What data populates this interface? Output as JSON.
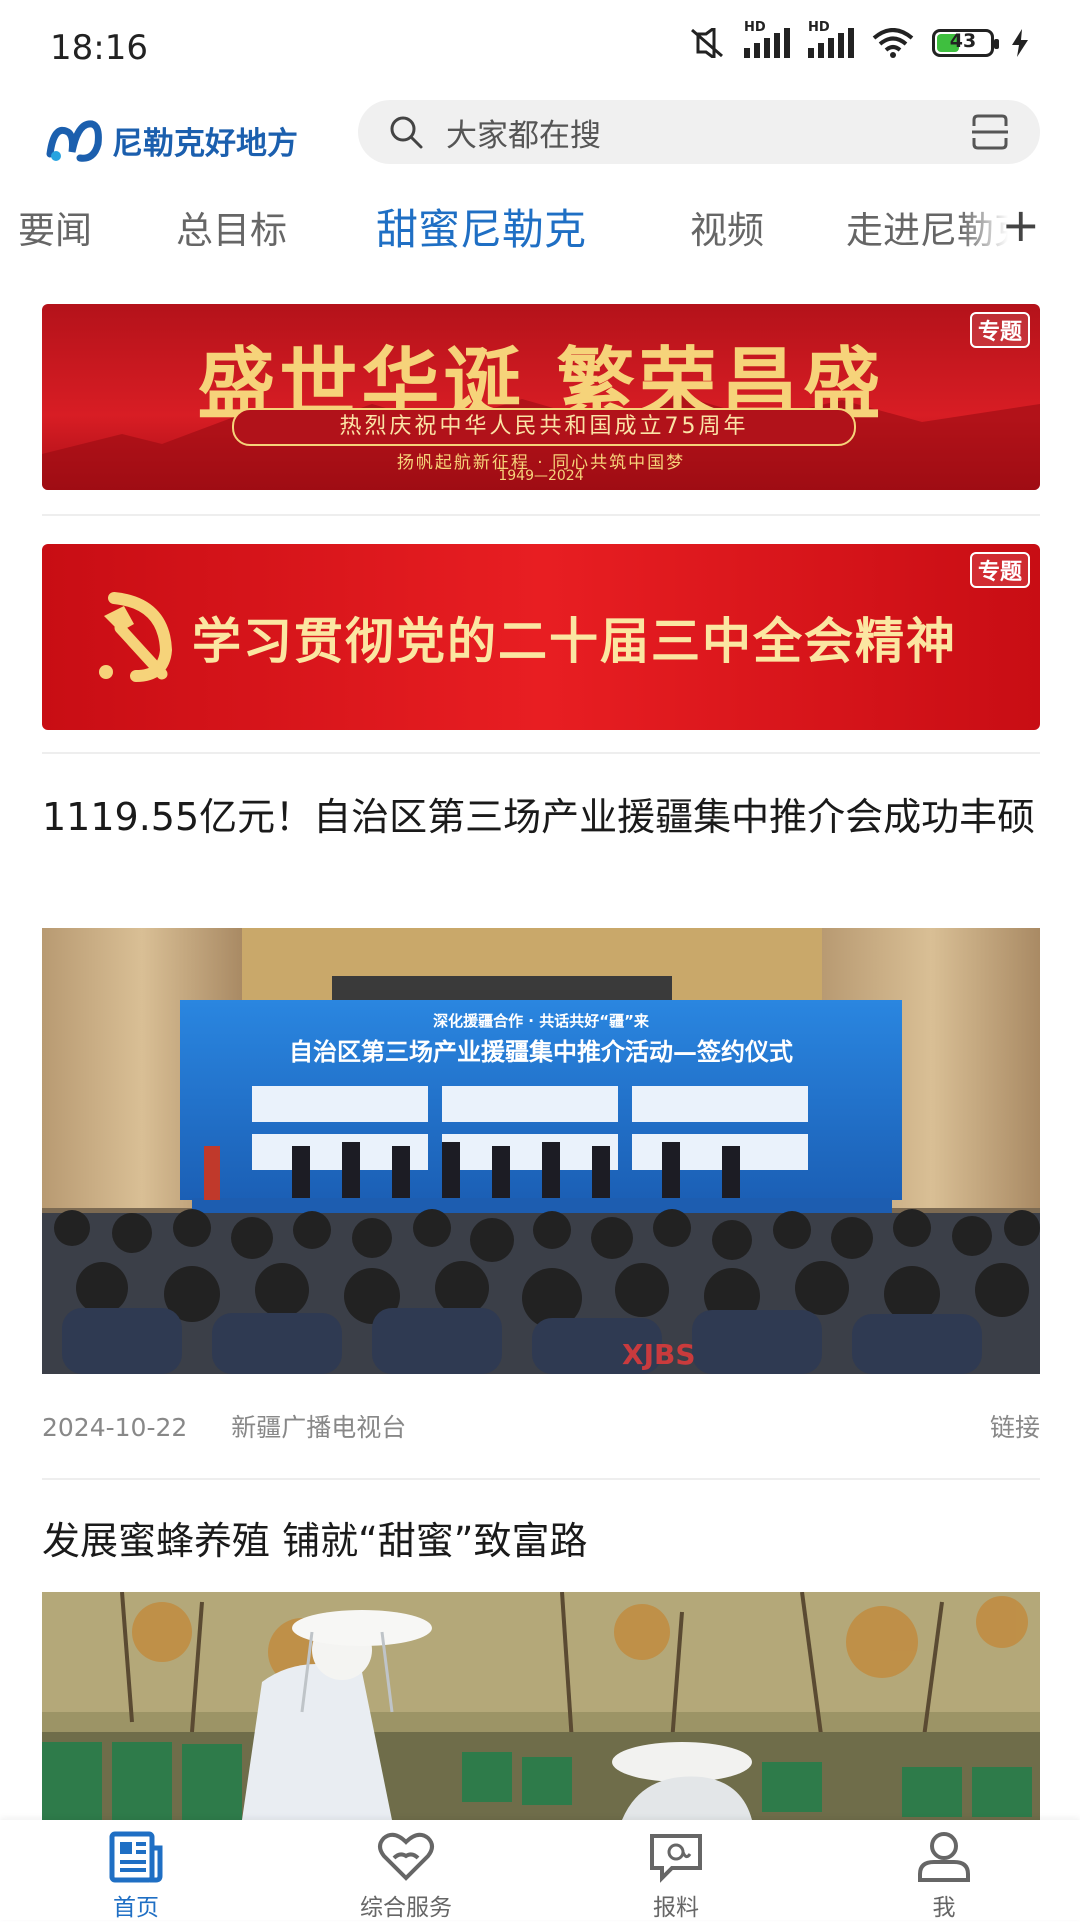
{
  "status_bar": {
    "time": "18:16",
    "battery": "43",
    "hd1": "HD",
    "hd2": "HD"
  },
  "header": {
    "app_name": "尼勒克好地方",
    "search_placeholder": "大家都在搜"
  },
  "tabs": [
    "要闻",
    "总目标",
    "甜蜜尼勒克",
    "视频",
    "走进尼勒克"
  ],
  "active_tab": "甜蜜尼勒克",
  "banners": [
    {
      "headline": "盛世华诞  繁荣昌盛",
      "subtitle": "热烈庆祝中华人民共和国成立75周年",
      "slogan": "扬帆起航新征程 · 同心共筑中国梦",
      "years": "1949—2024",
      "tag": "专题"
    },
    {
      "headline": "学习贯彻党的二十届三中全会精神",
      "tag": "专题"
    }
  ],
  "articles": [
    {
      "title": "1119.55亿元！自治区第三场产业援疆集中推介会成功丰硕",
      "image_text_top": "深化援疆合作 · 共话共好“疆”来",
      "image_text_main": "自治区第三场产业援疆集中推介活动—签约仪式",
      "image_watermark": "XJBS",
      "date": "2024-10-22",
      "source": "新疆广播电视台",
      "link_label": "链接"
    },
    {
      "title": "发展蜜蜂养殖 铺就“甜蜜”致富路"
    }
  ],
  "bottom_nav": [
    {
      "label": "首页",
      "icon": "news-icon",
      "active": true
    },
    {
      "label": "综合服务",
      "icon": "heart-service-icon",
      "active": false
    },
    {
      "label": "报料",
      "icon": "report-icon",
      "active": false
    },
    {
      "label": "我",
      "icon": "user-icon",
      "active": false
    }
  ],
  "colors": {
    "accent": "#1f6fc4",
    "banner_red": "#d81d24",
    "banner_gold": "#f6d37a"
  }
}
